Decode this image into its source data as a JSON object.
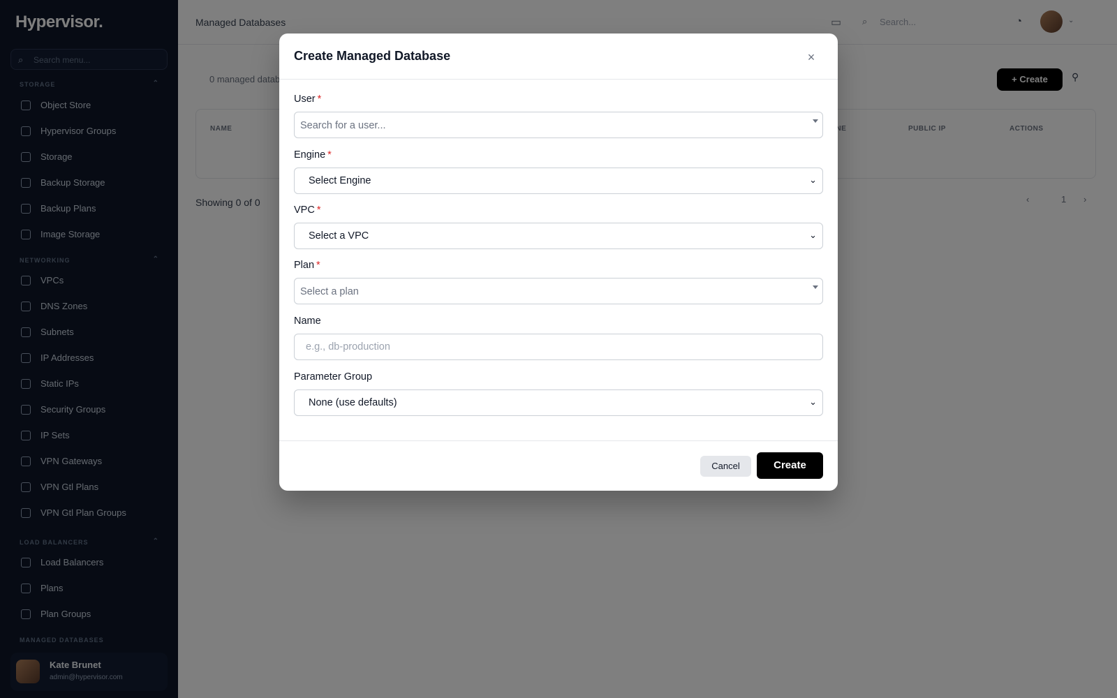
{
  "sidebar": {
    "brand": "Hypervisor.",
    "search_placeholder": "Search menu...",
    "sections": [
      {
        "title": "STORAGE",
        "items": [
          "Object Store",
          "Hypervisor Groups",
          "Storage",
          "Backup Storage",
          "Backup Plans",
          "Image Storage"
        ]
      },
      {
        "title": "NETWORKING",
        "items": [
          "VPCs",
          "DNS Zones",
          "Subnets",
          "IP Addresses",
          "Static IPs",
          "Security Groups",
          "IP Sets",
          "VPN Gateways",
          "VPN Gtl Plans",
          "VPN Gtl Plan Groups"
        ]
      },
      {
        "title": "LOAD BALANCERS",
        "items": [
          "Load Balancers",
          "Plans",
          "Plan Groups"
        ]
      },
      {
        "title": "MANAGED DATABASES",
        "items": []
      }
    ],
    "user": {
      "name": "Kate Brunet",
      "email": "admin@hypervisor.com"
    }
  },
  "topbar": {
    "page_title": "Managed Databases",
    "search_placeholder": "Search..."
  },
  "main": {
    "count_text": "0 managed databases",
    "create_label": "Create",
    "columns": [
      "NAME",
      "",
      "",
      "",
      "",
      "",
      "ENGINE",
      "PUBLIC IP",
      "ACTIONS"
    ],
    "showing_text": "Showing 0 of 0",
    "page_number": "1"
  },
  "modal": {
    "title": "Create Managed Database",
    "close_glyph": "×",
    "required_marker": "*",
    "fields": {
      "user": {
        "label": "User",
        "placeholder": "Search for a user..."
      },
      "engine": {
        "label": "Engine",
        "value": "Select Engine"
      },
      "vpc": {
        "label": "VPC",
        "value": "Select a VPC"
      },
      "plan": {
        "label": "Plan",
        "placeholder": "Select a plan"
      },
      "name": {
        "label": "Name",
        "placeholder": "e.g., db-production"
      },
      "parameter_group": {
        "label": "Parameter Group",
        "value": "None (use defaults)"
      }
    },
    "cancel_label": "Cancel",
    "create_label": "Create"
  }
}
